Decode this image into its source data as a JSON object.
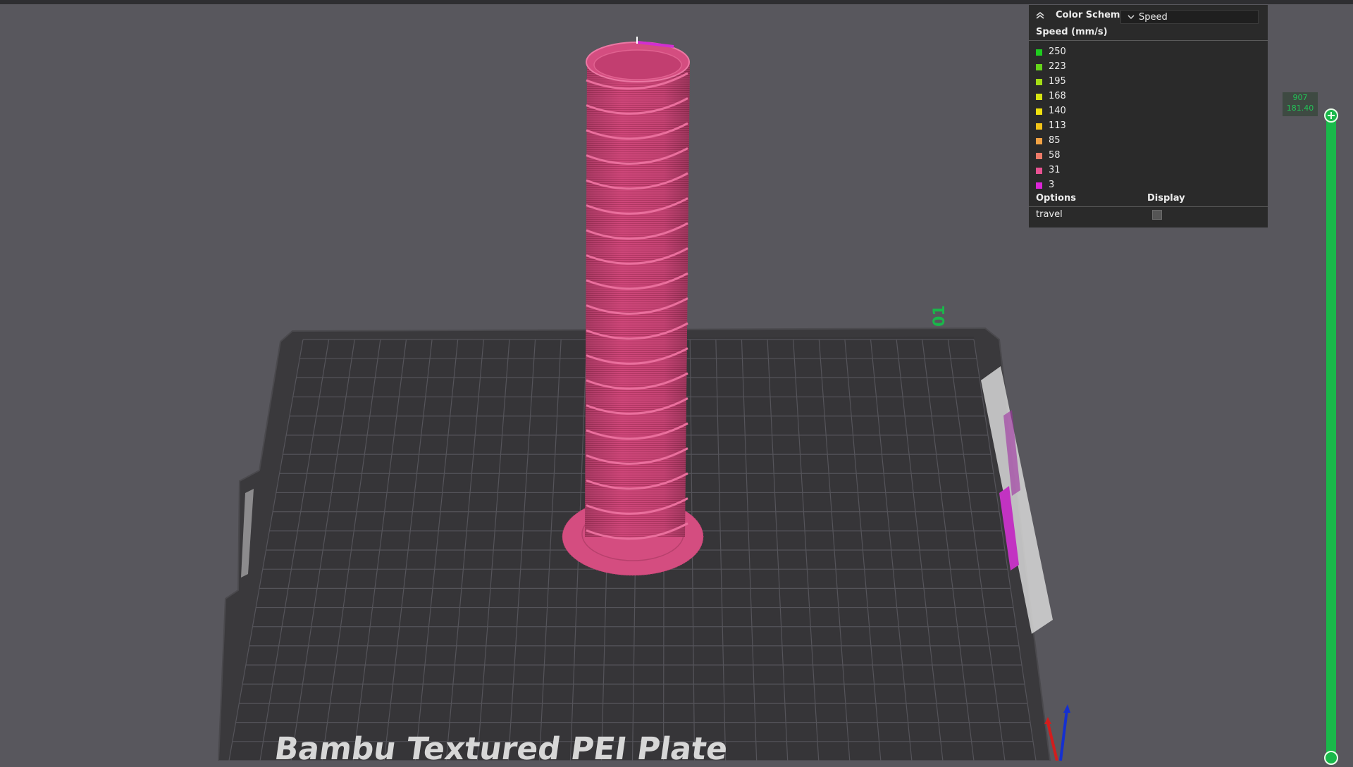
{
  "legend": {
    "title": "Color Scheme",
    "scheme_value": "Speed",
    "speed_header": "Speed (mm/s)",
    "speeds": [
      {
        "label": "250",
        "color": "#1fcc1f"
      },
      {
        "label": "223",
        "color": "#66d51a"
      },
      {
        "label": "195",
        "color": "#a4dd15"
      },
      {
        "label": "168",
        "color": "#d6e412"
      },
      {
        "label": "140",
        "color": "#f0e10f"
      },
      {
        "label": "113",
        "color": "#f3c418"
      },
      {
        "label": "85",
        "color": "#f2a244"
      },
      {
        "label": "58",
        "color": "#ee7a68"
      },
      {
        "label": "31",
        "color": "#e85292"
      },
      {
        "label": "3",
        "color": "#dc25d8"
      }
    ],
    "options_header": "Options",
    "display_header": "Display",
    "travel_label": "travel"
  },
  "layer_slider": {
    "top_layer": "907",
    "top_height": "181.40"
  },
  "plate": {
    "name": "Bambu Textured PEI Plate",
    "corner_mark": "01"
  },
  "colors": {
    "background": "#58575d",
    "plate": "#3a393c",
    "grid": "#5a595e",
    "model": "#d04a7a",
    "slider": "#19b84a"
  }
}
